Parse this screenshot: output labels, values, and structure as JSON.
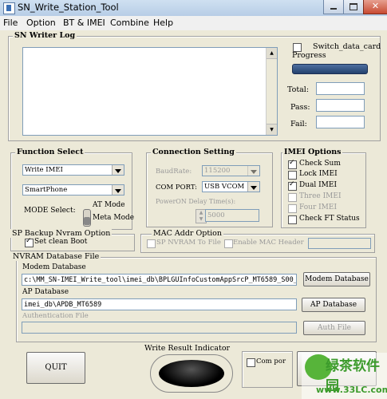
{
  "window": {
    "title": "SN_Write_Station_Tool"
  },
  "menu": [
    "File",
    "Option",
    "BT & IMEI",
    "Combine",
    "Help"
  ],
  "sn_writer_log": {
    "label": "SN Writer Log",
    "switch_data_card": "Switch_data_card",
    "progress": "Progress",
    "total": "Total:",
    "pass": "Pass:",
    "fail": "Fail:"
  },
  "function_select": {
    "label": "Function Select",
    "function": "Write IMEI",
    "target": "SmartPhone",
    "mode_select": "MODE Select:",
    "at_mode": "AT Mode",
    "meta_mode": "Meta Mode"
  },
  "connection": {
    "label": "Connection Setting",
    "baudrate_label": "BaudRate:",
    "baudrate_value": "115200",
    "com_port_label": "COM PORT:",
    "com_port_value": "USB VCOM",
    "powerup_label": "PowerON Delay Time(s):",
    "powerup_value": "5000"
  },
  "imei_options": {
    "label": "IMEI Options",
    "items": [
      {
        "label": "Check Sum",
        "checked": true,
        "enabled": true
      },
      {
        "label": "Lock IMEI",
        "checked": false,
        "enabled": true
      },
      {
        "label": "Dual IMEI",
        "checked": true,
        "enabled": true
      },
      {
        "label": "Three IMEI",
        "checked": false,
        "enabled": false
      },
      {
        "label": "Four IMEI",
        "checked": false,
        "enabled": false
      },
      {
        "label": "Check FT Status",
        "checked": false,
        "enabled": true
      }
    ]
  },
  "sp_backup": {
    "label": "SP Backup Nvram Option",
    "set_clean_boot": "Set clean Boot",
    "checked": true
  },
  "mac_addr": {
    "label": "MAC Addr Option",
    "sp_nvram_to_file": "SP NVRAM To File",
    "enable_mac_header": "Enable MAC Header"
  },
  "nvram_db": {
    "label": "NVRAM Database File",
    "modem_db_label": "Modem Database",
    "modem_db_path": "c:\\MM_SN-IMEI_Write_tool\\imei_db\\BPLGUInfoCustomAppSrcP_MT6589_S00_M",
    "modem_db_button": "Modem Database",
    "ap_db_label": "AP Database",
    "ap_db_path": "imei_db\\APDB_MT6589",
    "ap_db_button": "AP Database",
    "auth_file_label": "Authentication File",
    "auth_file_button": "Auth File"
  },
  "bottom": {
    "quit": "QUIT",
    "write_result_label": "Write Result Indicator",
    "com_port_text": "Com por"
  },
  "watermark": {
    "text": "绿茶软件园",
    "url": "www.33LC.com"
  }
}
